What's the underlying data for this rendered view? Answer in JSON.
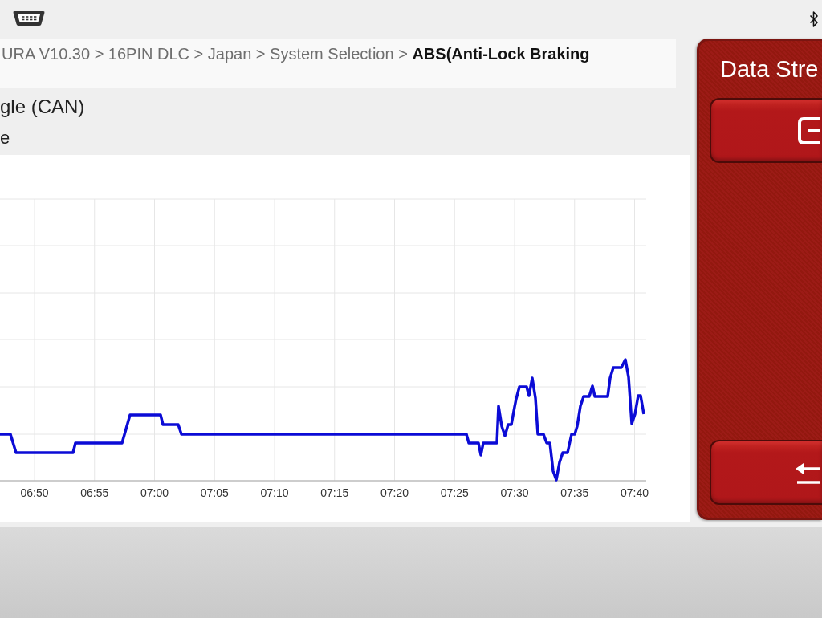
{
  "breadcrumb": "URA V10.30 > 16PIN DLC > Japan > System Selection > **ABS(Anti-Lock Braking**",
  "heading": "gle (CAN)",
  "subheading": "e",
  "graph": {
    "time_labels": [
      "06:50",
      "06:55",
      "07:00",
      "07:05",
      "07:10",
      "07:15",
      "07:20",
      "07:25",
      "07:30",
      "07:35",
      "07:40"
    ]
  },
  "side_panel": {
    "title": "Data Stre",
    "buttons": [
      {
        "kind": "box"
      },
      {
        "kind": "arrows"
      }
    ]
  }
}
